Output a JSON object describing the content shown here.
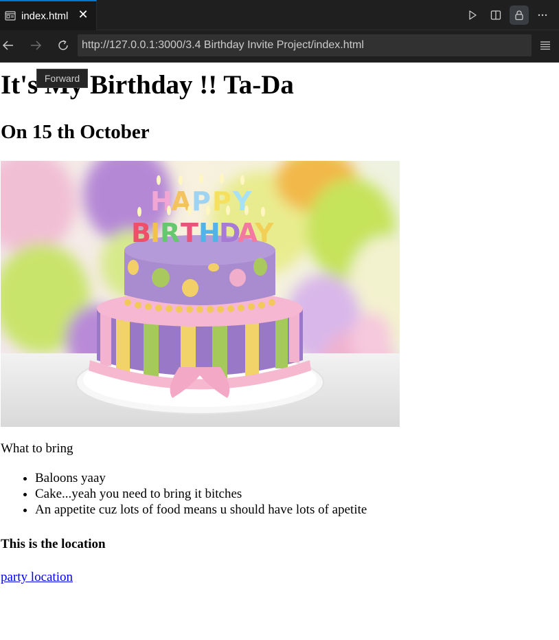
{
  "tab": {
    "label": "index.html",
    "close_glyph": "✕",
    "icon": "preview-icon"
  },
  "tab_actions": [
    "run-icon",
    "split-editor-icon",
    "lock-icon",
    "more-icon"
  ],
  "toolbar": {
    "back_icon": "arrow-left-icon",
    "forward_icon": "arrow-right-icon",
    "reload_icon": "reload-icon",
    "url": "http://127.0.0.1:3000/3.4 Birthday Invite Project/index.html",
    "menu_icon": "menu-icon"
  },
  "tooltip": {
    "text": "Forward"
  },
  "page": {
    "title": "It's My Birthday !! Ta-Da",
    "date": "On 15 th October",
    "bring_label": "What to bring",
    "items": [
      "Baloons yaay",
      "Cake...yeah you need to bring it bitches",
      "An appetite cuz lots of food means u should have lots of apetite"
    ],
    "location_heading": "This is the location",
    "location_link": "party location",
    "link_color": "#0000ee"
  },
  "colors": {
    "chrome_bg": "#1f1f1f",
    "tab_active_border": "#0078d4",
    "url_bg": "#313131"
  }
}
